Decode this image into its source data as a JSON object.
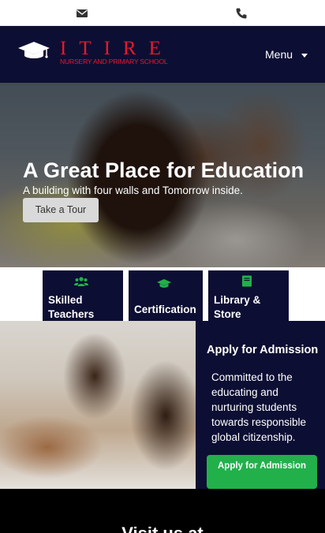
{
  "topbar": {
    "mail_icon": "envelope-icon",
    "phone_icon": "phone-icon"
  },
  "header": {
    "logo_name": "ITIRE",
    "logo_tagline": "NURSERY AND PRIMARY SCHOOL",
    "menu_label": "Menu",
    "colors": {
      "background": "#0d0e33",
      "brand": "#e8192c"
    }
  },
  "hero": {
    "title": "A Great Place for Education",
    "subtitle": "A building with four walls and Tomorrow inside.",
    "button_label": "Take a Tour"
  },
  "features": [
    {
      "icon": "users-icon",
      "label": "Skilled Teachers"
    },
    {
      "icon": "graduation-cap-icon",
      "label": "Certification"
    },
    {
      "icon": "book-icon",
      "label": "Library & Store"
    }
  ],
  "admission": {
    "title": "Apply for Admission",
    "text": "Committed to the educating and nurturing students towards responsible global citizenship.",
    "button_label": "Apply for Admission",
    "colors": {
      "button": "#22b04b",
      "icons": "#22b04b"
    }
  },
  "visit": {
    "title": "Visit us at"
  }
}
